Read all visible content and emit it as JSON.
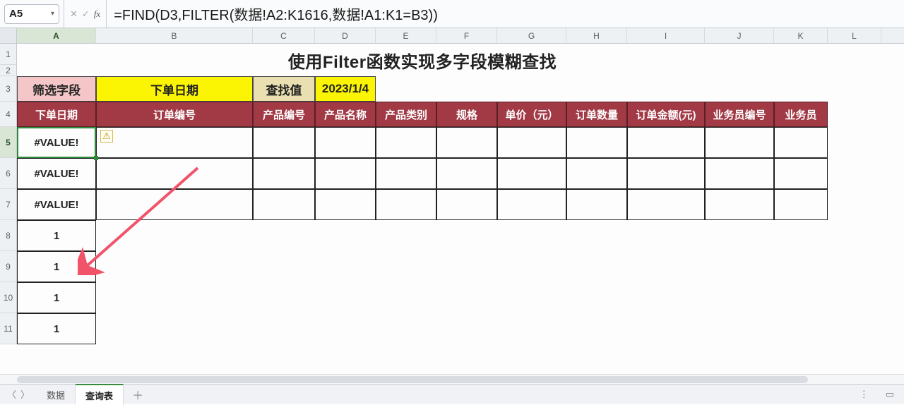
{
  "namebox": {
    "selected_cell": "A5"
  },
  "formula_bar": {
    "text": "=FIND(D3,FILTER(数据!A2:K1616,数据!A1:K1=B3))"
  },
  "columns": [
    "A",
    "B",
    "C",
    "D",
    "E",
    "F",
    "G",
    "H",
    "I",
    "J",
    "K",
    "L"
  ],
  "rows_visible": [
    "1",
    "2",
    "3",
    "4",
    "5",
    "6",
    "7",
    "8",
    "9",
    "10",
    "11"
  ],
  "title": "使用Filter函数实现多字段模糊查找",
  "criteria_row": {
    "label_field": "筛选字段",
    "selected_field": "下单日期",
    "label_search": "查找值",
    "search_value": "2023/1/4"
  },
  "headers": [
    "下单日期",
    "订单编号",
    "产品编号",
    "产品名称",
    "产品类别",
    "规格",
    "单价（元）",
    "订单数量",
    "订单金额(元)",
    "业务员编号",
    "业务员"
  ],
  "colA_values": [
    "#VALUE!",
    "#VALUE!",
    "#VALUE!",
    "1",
    "1",
    "1",
    "1"
  ],
  "sheet_tabs": {
    "tabs": [
      "数据",
      "查询表"
    ],
    "active_index": 1
  },
  "chart_data": null
}
